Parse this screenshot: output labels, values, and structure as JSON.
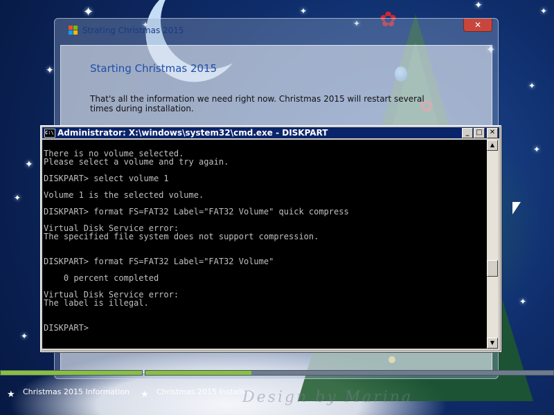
{
  "background": {
    "theme": "christmas-wallpaper",
    "watermark": "Design by Marina"
  },
  "setup_window": {
    "title": "Strating Christmas 2015",
    "heading": "Starting Christmas 2015",
    "text": "That's all the information we need right now. Christmas 2015 will restart several times during installation.",
    "close_label": "✕"
  },
  "cmd_window": {
    "title": "Administrator: X:\\windows\\system32\\cmd.exe - DISKPART",
    "icon_label": "C:\\",
    "buttons": {
      "minimize": "_",
      "maximize": "□",
      "close": "✕"
    },
    "lines": [
      "There is no volume selected.",
      "Please select a volume and try again.",
      "",
      "DISKPART> select volume 1",
      "",
      "Volume 1 is the selected volume.",
      "",
      "DISKPART> format FS=FAT32 Label=\"FAT32 Volume\" quick compress",
      "",
      "Virtual Disk Service error:",
      "The specified file system does not support compression.",
      "",
      "",
      "DISKPART> format FS=FAT32 Label=\"FAT32 Volume\"",
      "",
      "    0 percent completed",
      "",
      "Virtual Disk Service error:",
      "The label is illegal.",
      "",
      "",
      "DISKPART>"
    ]
  },
  "status_bar": {
    "steps": [
      {
        "label": "Christmas 2015 Information",
        "progress": 1.0
      },
      {
        "label": "Christmas 2015 Installing",
        "progress": 0.26
      }
    ]
  },
  "colors": {
    "progress_fill": "#88c040",
    "titlebar": "#0a246a",
    "console_bg": "#000000",
    "console_text": "#c0c0c0"
  }
}
